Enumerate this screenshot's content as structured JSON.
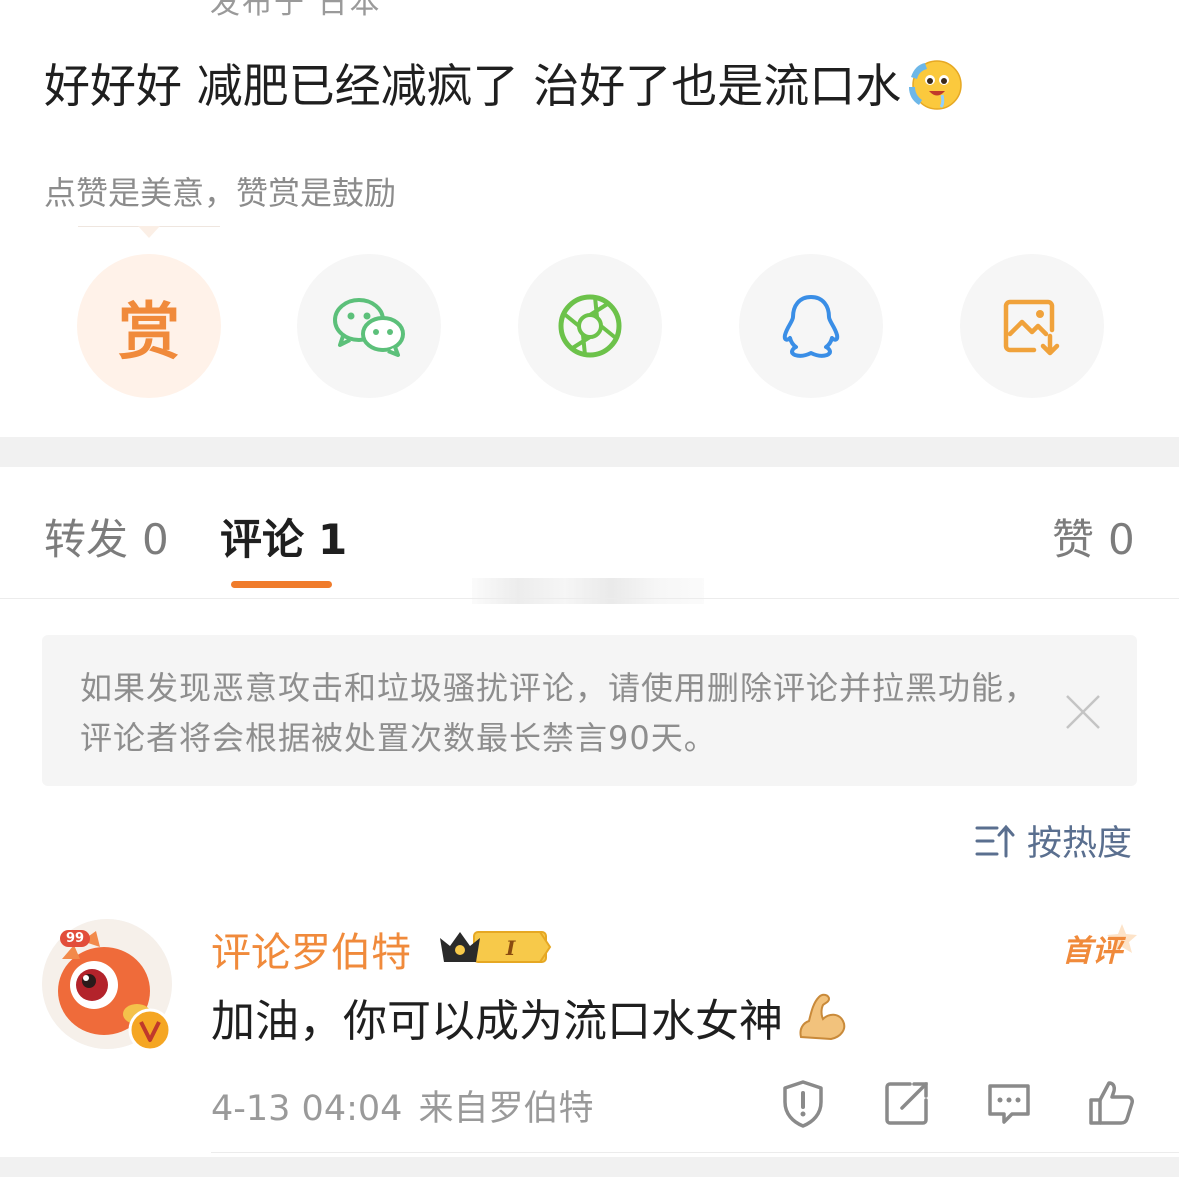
{
  "post": {
    "location_cut": "发布于 日本",
    "text": "好好好 减肥已经减疯了 治好了也是流口水",
    "emoji": "drooling-face",
    "reward_hint": "点赞是美意，赞赏是鼓励"
  },
  "share": {
    "reward_label": "赏",
    "items": [
      "reward",
      "wechat",
      "moments",
      "qq",
      "save-image"
    ]
  },
  "tabs": {
    "repost": {
      "label": "转发",
      "count": "0"
    },
    "comments": {
      "label": "评论",
      "count": "1"
    },
    "likes": {
      "label": "赞",
      "count": "0"
    }
  },
  "notice": {
    "text": "如果发现恶意攻击和垃圾骚扰评论，请使用删除评论并拉黑功能，评论者将会根据被处置次数最长禁言90天。"
  },
  "sort": {
    "label": "按热度"
  },
  "comment": {
    "username": "评论罗伯特",
    "avatar_badge": "99",
    "vip_level": "I",
    "first_badge": "首评",
    "text": "加油，你可以成为流口水女神",
    "emoji": "flexed-biceps",
    "time": "4-13 04:04",
    "source": "来自罗伯特"
  },
  "colors": {
    "accent": "#f08a3b",
    "tab_indicator": "#f07c2c",
    "sort_blue": "#5a6f8f",
    "wechat_green": "#5cc07a",
    "moments_green": "#6cc24a",
    "qq_blue": "#3a8ee6"
  }
}
